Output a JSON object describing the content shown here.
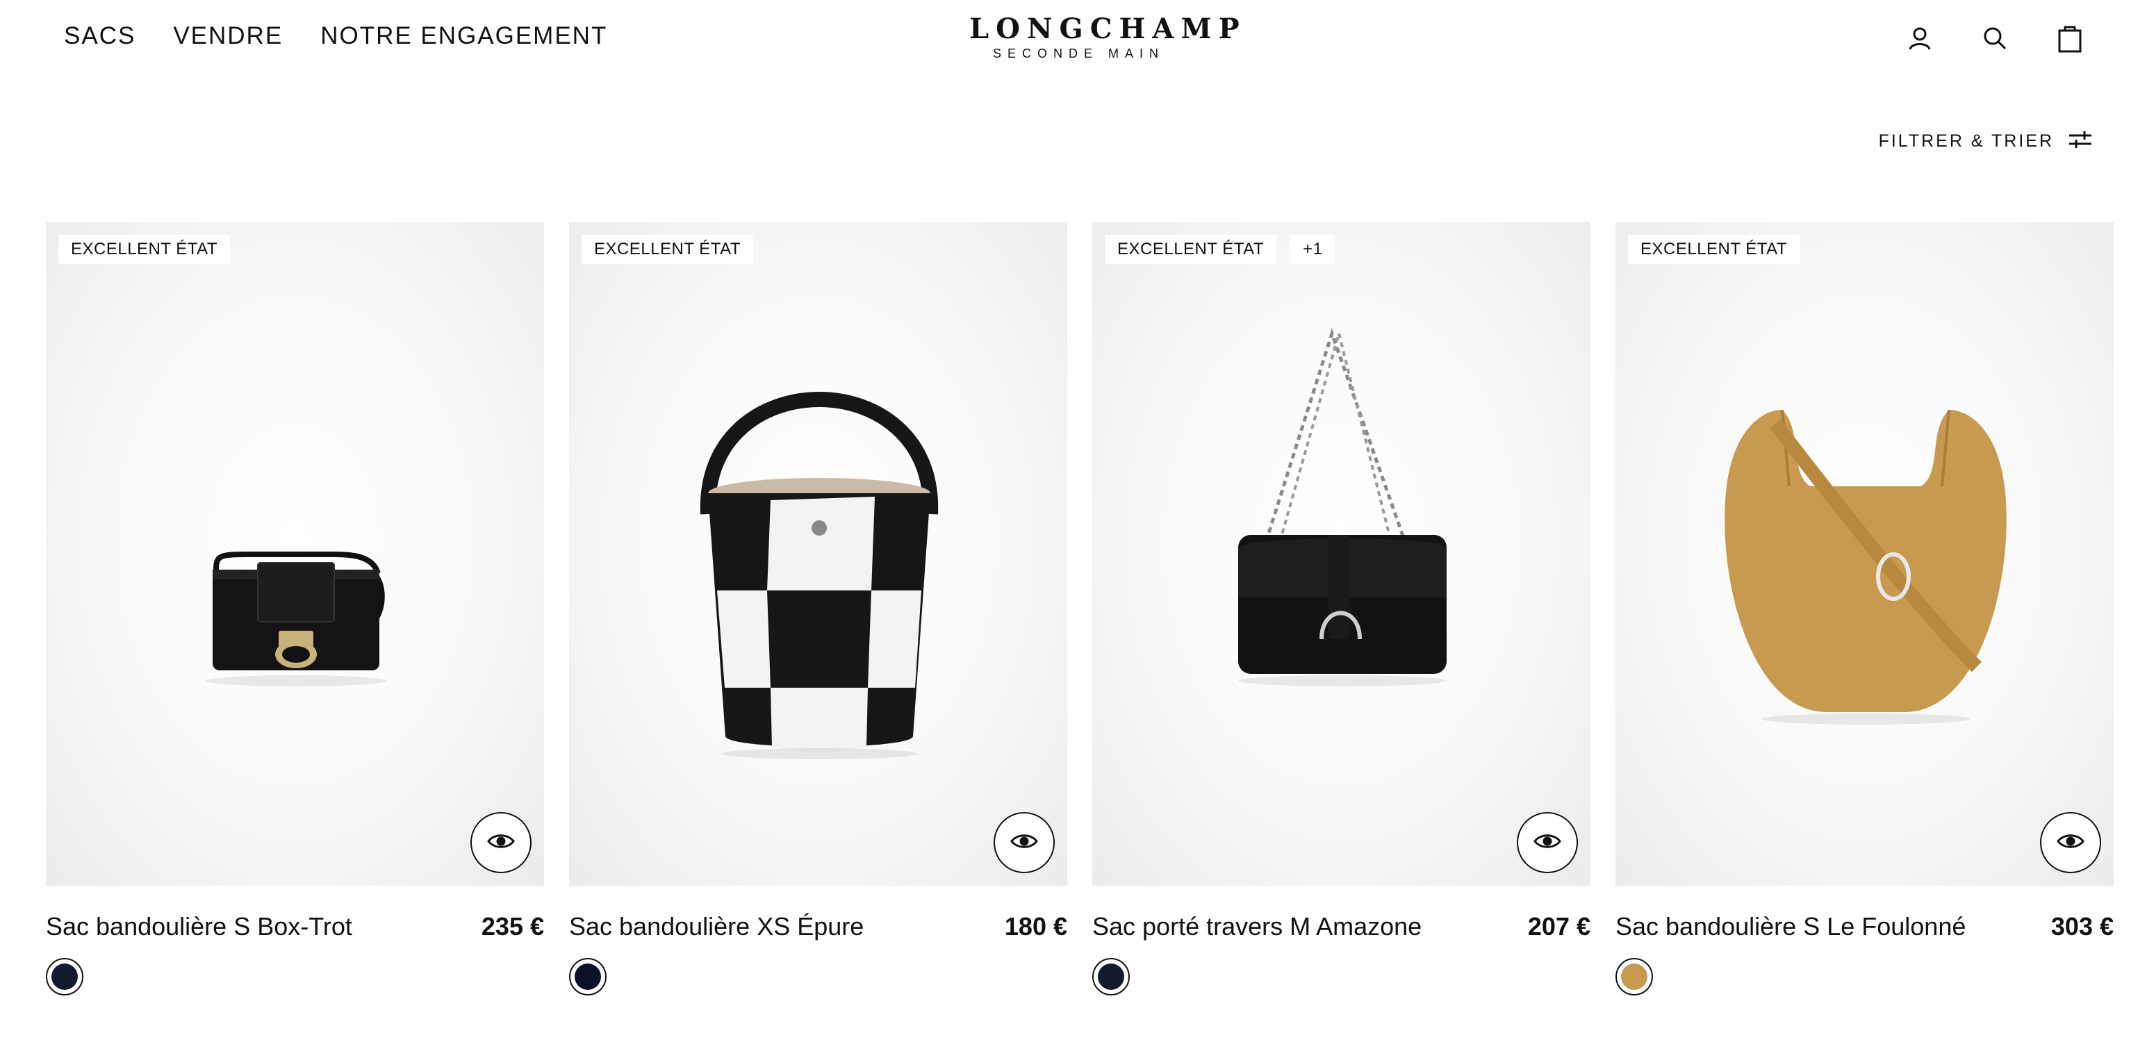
{
  "nav": {
    "items": [
      "SACS",
      "VENDRE",
      "NOTRE ENGAGEMENT"
    ]
  },
  "logo": {
    "main": "LONGCHAMP",
    "sub": "SECONDE MAIN"
  },
  "header_icons": [
    "account-icon",
    "search-icon",
    "shopping-bag-icon"
  ],
  "toolbar": {
    "label": "FILTRER & TRIER",
    "icon": "filter-sliders-icon"
  },
  "products": [
    {
      "badges": [
        "EXCELLENT ÉTAT"
      ],
      "name": "Sac bandoulière S Box-Trot",
      "price": "235 €",
      "swatch": "#141a2e"
    },
    {
      "badges": [
        "EXCELLENT ÉTAT"
      ],
      "name": "Sac bandoulière XS Épure",
      "price": "180 €",
      "swatch": "#0c1029"
    },
    {
      "badges": [
        "EXCELLENT ÉTAT",
        "+1"
      ],
      "name": "Sac porté travers M Amazone",
      "price": "207 €",
      "swatch": "#141a2e"
    },
    {
      "badges": [
        "EXCELLENT ÉTAT"
      ],
      "name": "Sac bandoulière S Le Foulonné",
      "price": "303 €",
      "swatch": "#c79a4f"
    }
  ],
  "colors": {
    "text": "#111111",
    "background": "#ffffff",
    "card_bg": "#f2f2f2"
  }
}
